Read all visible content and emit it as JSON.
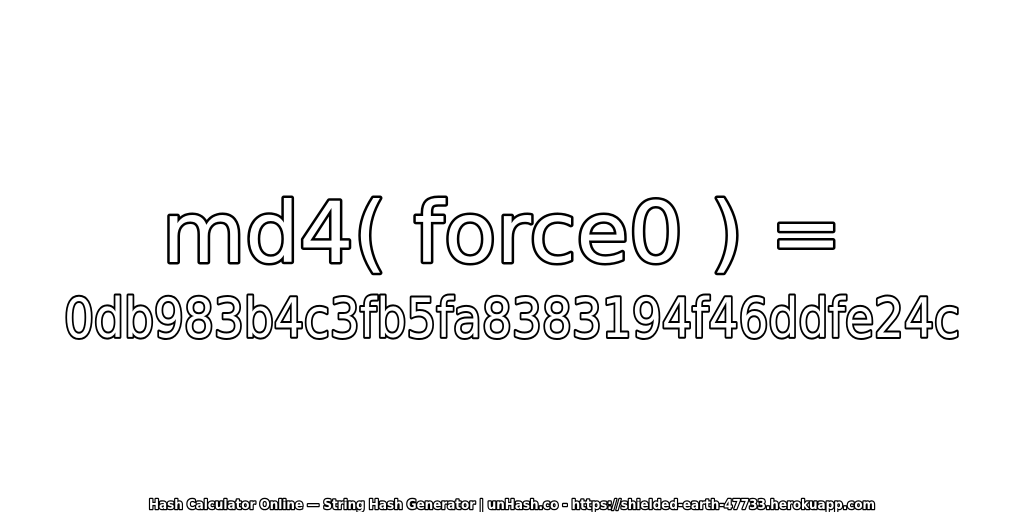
{
  "headline": "md4( force0 ) =",
  "hash_value": "0db983b4c3fb5fa8383194f46ddfe24c",
  "footer": "Hash Calculator Online — String Hash Generator | unHash.co - https://shielded-earth-47733.herokuapp.com",
  "colors": {
    "background": "#ffffff",
    "text_fill": "#ffffff",
    "text_outline": "#000000"
  }
}
